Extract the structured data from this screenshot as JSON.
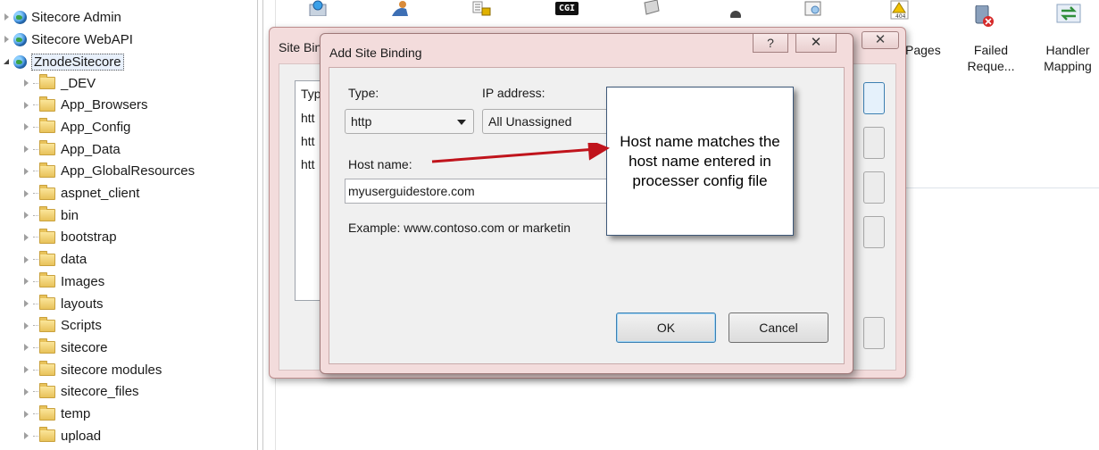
{
  "tree": {
    "sites": [
      {
        "label": "Sitecore Admin",
        "expanded": false
      },
      {
        "label": "Sitecore WebAPI",
        "expanded": false
      },
      {
        "label": "ZnodeSitecore",
        "expanded": true
      }
    ],
    "folders": [
      "_DEV",
      "App_Browsers",
      "App_Config",
      "App_Data",
      "App_GlobalResources",
      "aspnet_client",
      "bin",
      "bootstrap",
      "data",
      "Images",
      "layouts",
      "Scripts",
      "sitecore",
      "sitecore modules",
      "sitecore_files",
      "temp",
      "upload"
    ]
  },
  "toolbar": {
    "error_pages_partial": "Pages",
    "failed_requests": {
      "line1": "Failed",
      "line2": "Reque..."
    },
    "handler_mappings": {
      "line1": "Handler",
      "line2": "Mapping"
    },
    "cgi_icon_text": "CGI"
  },
  "site_bindings": {
    "title_partial": "Site Bin",
    "col_type_partial": "Typ",
    "rows": [
      "htt",
      "htt",
      "htt"
    ],
    "close_glyph": "✕"
  },
  "add_binding": {
    "title": "Add Site Binding",
    "help_glyph": "?",
    "close_glyph": "✕",
    "type_label": "Type:",
    "type_value": "http",
    "ip_label": "IP address:",
    "ip_value": "All Unassigned",
    "host_label": "Host name:",
    "host_value": "myuserguidestore.com",
    "example_text": "Example: www.contoso.com or marketin",
    "ok_label": "OK",
    "cancel_label": "Cancel"
  },
  "callout": {
    "text": "Host name matches the host name entered in processer config file"
  },
  "colors": {
    "dialog_frame": "#f3dcdc",
    "arrow": "#c0141c",
    "callout_border": "#3e5878"
  }
}
